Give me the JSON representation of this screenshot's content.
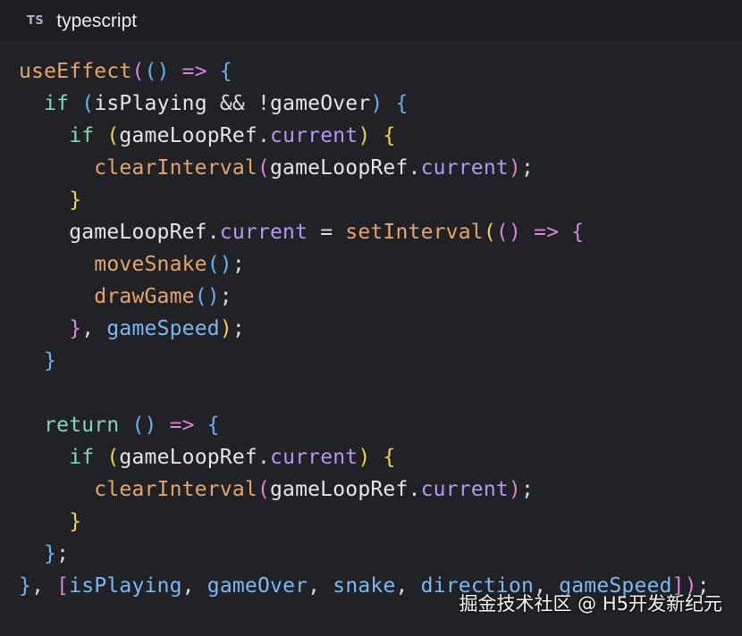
{
  "header": {
    "icon_text": "TS",
    "language": "typescript"
  },
  "code": {
    "lines": [
      {
        "indent": 0,
        "tokens": [
          {
            "t": "useEffect",
            "c": "fn"
          },
          {
            "t": "(",
            "c": "p1"
          },
          {
            "t": "()",
            "c": "p2"
          },
          {
            "t": " => ",
            "c": "arrow"
          },
          {
            "t": "{",
            "c": "p2"
          }
        ]
      },
      {
        "indent": 1,
        "tokens": [
          {
            "t": "if ",
            "c": "kw"
          },
          {
            "t": "(",
            "c": "p2"
          },
          {
            "t": "isPlaying",
            "c": "var"
          },
          {
            "t": " && !",
            "c": "op"
          },
          {
            "t": "gameOver",
            "c": "var"
          },
          {
            "t": ")",
            "c": "p2"
          },
          {
            "t": " {",
            "c": "p2"
          }
        ]
      },
      {
        "indent": 2,
        "tokens": [
          {
            "t": "if ",
            "c": "kw"
          },
          {
            "t": "(",
            "c": "p3"
          },
          {
            "t": "gameLoopRef",
            "c": "var"
          },
          {
            "t": ".",
            "c": "op"
          },
          {
            "t": "current",
            "c": "prop"
          },
          {
            "t": ")",
            "c": "p3"
          },
          {
            "t": " {",
            "c": "p3"
          }
        ]
      },
      {
        "indent": 3,
        "tokens": [
          {
            "t": "clearInterval",
            "c": "fn"
          },
          {
            "t": "(",
            "c": "p1"
          },
          {
            "t": "gameLoopRef",
            "c": "var"
          },
          {
            "t": ".",
            "c": "op"
          },
          {
            "t": "current",
            "c": "prop"
          },
          {
            "t": ")",
            "c": "p1"
          },
          {
            "t": ";",
            "c": "op"
          }
        ]
      },
      {
        "indent": 2,
        "tokens": [
          {
            "t": "}",
            "c": "p3"
          }
        ]
      },
      {
        "indent": 2,
        "tokens": [
          {
            "t": "gameLoopRef",
            "c": "var"
          },
          {
            "t": ".",
            "c": "op"
          },
          {
            "t": "current",
            "c": "prop"
          },
          {
            "t": " = ",
            "c": "op"
          },
          {
            "t": "setInterval",
            "c": "fn"
          },
          {
            "t": "(",
            "c": "p3"
          },
          {
            "t": "()",
            "c": "p1"
          },
          {
            "t": " => ",
            "c": "arrow"
          },
          {
            "t": "{",
            "c": "p1"
          }
        ]
      },
      {
        "indent": 3,
        "tokens": [
          {
            "t": "moveSnake",
            "c": "fn"
          },
          {
            "t": "()",
            "c": "p2"
          },
          {
            "t": ";",
            "c": "op"
          }
        ]
      },
      {
        "indent": 3,
        "tokens": [
          {
            "t": "drawGame",
            "c": "fn"
          },
          {
            "t": "()",
            "c": "p2"
          },
          {
            "t": ";",
            "c": "op"
          }
        ]
      },
      {
        "indent": 2,
        "tokens": [
          {
            "t": "}",
            "c": "p1"
          },
          {
            "t": ", ",
            "c": "op"
          },
          {
            "t": "gameSpeed",
            "c": "arg"
          },
          {
            "t": ")",
            "c": "p3"
          },
          {
            "t": ";",
            "c": "op"
          }
        ]
      },
      {
        "indent": 1,
        "tokens": [
          {
            "t": "}",
            "c": "p2"
          }
        ]
      },
      {
        "indent": 0,
        "tokens": []
      },
      {
        "indent": 1,
        "tokens": [
          {
            "t": "return ",
            "c": "kw"
          },
          {
            "t": "()",
            "c": "p2"
          },
          {
            "t": " => ",
            "c": "arrow"
          },
          {
            "t": "{",
            "c": "p2"
          }
        ]
      },
      {
        "indent": 2,
        "tokens": [
          {
            "t": "if ",
            "c": "kw"
          },
          {
            "t": "(",
            "c": "p3"
          },
          {
            "t": "gameLoopRef",
            "c": "var"
          },
          {
            "t": ".",
            "c": "op"
          },
          {
            "t": "current",
            "c": "prop"
          },
          {
            "t": ")",
            "c": "p3"
          },
          {
            "t": " {",
            "c": "p3"
          }
        ]
      },
      {
        "indent": 3,
        "tokens": [
          {
            "t": "clearInterval",
            "c": "fn"
          },
          {
            "t": "(",
            "c": "p1"
          },
          {
            "t": "gameLoopRef",
            "c": "var"
          },
          {
            "t": ".",
            "c": "op"
          },
          {
            "t": "current",
            "c": "prop"
          },
          {
            "t": ")",
            "c": "p1"
          },
          {
            "t": ";",
            "c": "op"
          }
        ]
      },
      {
        "indent": 2,
        "tokens": [
          {
            "t": "}",
            "c": "p3"
          }
        ]
      },
      {
        "indent": 1,
        "tokens": [
          {
            "t": "}",
            "c": "p2"
          },
          {
            "t": ";",
            "c": "op"
          }
        ]
      },
      {
        "indent": 0,
        "tokens": [
          {
            "t": "}",
            "c": "p2"
          },
          {
            "t": ", ",
            "c": "op"
          },
          {
            "t": "[",
            "c": "p1"
          },
          {
            "t": "isPlaying",
            "c": "arg"
          },
          {
            "t": ", ",
            "c": "op"
          },
          {
            "t": "gameOver",
            "c": "arg"
          },
          {
            "t": ", ",
            "c": "op"
          },
          {
            "t": "snake",
            "c": "arg"
          },
          {
            "t": ", ",
            "c": "op"
          },
          {
            "t": "direction",
            "c": "arg"
          },
          {
            "t": ", ",
            "c": "op"
          },
          {
            "t": "gameSpeed",
            "c": "arg"
          },
          {
            "t": "]",
            "c": "p1"
          },
          {
            "t": ")",
            "c": "p1"
          },
          {
            "t": ";",
            "c": "op"
          }
        ]
      }
    ]
  },
  "watermark": "掘金技术社区 @ H5开发新纪元"
}
